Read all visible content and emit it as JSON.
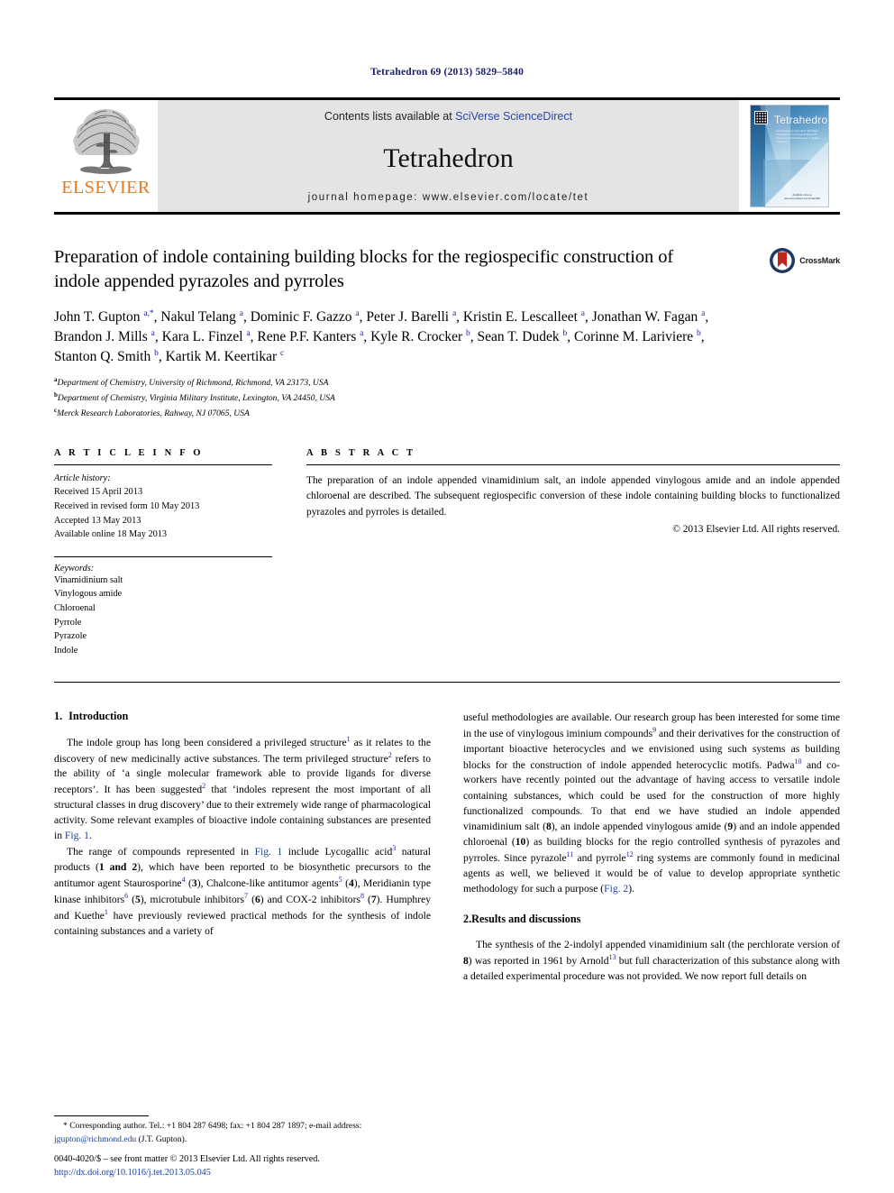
{
  "running_head": "Tetrahedron 69 (2013) 5829–5840",
  "masthead": {
    "publisher_name": "ELSEVIER",
    "contents_prefix": "Contents lists available at ",
    "contents_link": "SciVerse ScienceDirect",
    "journal_name": "Tetrahedron",
    "homepage": "journal homepage: www.elsevier.com/locate/tet",
    "cover": {
      "title": "Tetrahedron",
      "subtitle": "An International Journal for the Rapid Publication of Full Original Research Papers and Critical Reviews in Organic Chemistry",
      "footer": "Available online at www.sciencedirect.com ELSEVIER"
    }
  },
  "article": {
    "title": "Preparation of indole containing building blocks for the regiospecific construction of indole appended pyrazoles and pyrroles",
    "crossmark_label": "CrossMark",
    "authors_html": "John T. Gupton <sup>a,*</sup>, Nakul Telang <sup>a</sup>, Dominic F. Gazzo <sup>a</sup>, Peter J. Barelli <sup>a</sup>, Kristin E. Lescalleet <sup>a</sup>, Jonathan W. Fagan <sup>a</sup>, Brandon J. Mills <sup>a</sup>, Kara L. Finzel <sup>a</sup>, Rene P.F. Kanters <sup>a</sup>, Kyle R. Crocker <sup>b</sup>, Sean T. Dudek <sup>b</sup>, Corinne M. Lariviere <sup>b</sup>, Stanton Q. Smith <sup>b</sup>, Kartik M. Keertikar <sup>c</sup>",
    "affiliations": [
      {
        "marker": "a",
        "text": "Department of Chemistry, University of Richmond, Richmond, VA 23173, USA"
      },
      {
        "marker": "b",
        "text": "Department of Chemistry, Virginia Military Institute, Lexington, VA 24450, USA"
      },
      {
        "marker": "c",
        "text": "Merck Research Laboratories, Rahway, NJ 07065, USA"
      }
    ]
  },
  "info": {
    "heading": "A R T I C L E   I N F O",
    "history_label": "Article history:",
    "history": [
      "Received 15 April 2013",
      "Received in revised form 10 May 2013",
      "Accepted 13 May 2013",
      "Available online 18 May 2013"
    ],
    "keywords_label": "Keywords:",
    "keywords": [
      "Vinamidinium salt",
      "Vinylogous amide",
      "Chloroenal",
      "Pyrrole",
      "Pyrazole",
      "Indole"
    ]
  },
  "abstract": {
    "heading": "A B S T R A C T",
    "text": "The preparation of an indole appended vinamidinium salt, an indole appended vinylogous amide and an indole appended chloroenal are described. The subsequent regiospecific conversion of these indole containing building blocks to functionalized pyrazoles and pyrroles is detailed.",
    "copyright": "© 2013 Elsevier Ltd. All rights reserved."
  },
  "sections": {
    "introduction": {
      "number": "1.",
      "title": "Introduction"
    },
    "results": {
      "number": "2.",
      "title": "Results and discussions"
    }
  },
  "body": {
    "left_p1_html": "The indole group has long been considered a privileged structure<sup>1</sup> as it relates to the discovery of new medicinally active substances. The term privileged structure<sup>2</sup> refers to the ability of ‘a single molecular framework able to provide ligands for diverse receptors’. It has been suggested<sup>2</sup> that ‘indoles represent the most important of all structural classes in drug discovery’ due to their extremely wide range of pharmacological activity. Some relevant examples of bioactive indole containing substances are presented in <span class=\"lnk\">Fig. 1</span>.",
    "left_p2_html": "The range of compounds represented in <span class=\"lnk\">Fig. 1</span> include Lycogallic acid<sup>3</sup> natural products (<span class=\"bold\">1 and 2</span>), which have been reported to be biosynthetic precursors to the antitumor agent Staurosporine<sup>4</sup> (<span class=\"bold\">3</span>), Chalcone-like antitumor agents<sup>5</sup> (<span class=\"bold\">4</span>), Meridianin type kinase inhibitors<sup>6</sup> (<span class=\"bold\">5</span>), microtubule inhibitors<sup>7</sup> (<span class=\"bold\">6</span>) and COX-2 inhibitors<sup>8</sup> (<span class=\"bold\">7</span>). Humphrey and Kuethe<sup>1</sup> have previously reviewed practical methods for the synthesis of indole containing substances and a variety of",
    "right_p1_html": "useful methodologies are available. Our research group has been interested for some time in the use of vinylogous iminium compounds<sup>9</sup> and their derivatives for the construction of important bioactive heterocycles and we envisioned using such systems as building blocks for the construction of indole appended heterocyclic motifs. Padwa<sup>10</sup> and co-workers have recently pointed out the advantage of having access to versatile indole containing substances, which could be used for the construction of more highly functionalized compounds. To that end we have studied an indole appended vinamidinium salt (<span class=\"bold\">8</span>), an indole appended vinylogous amide (<span class=\"bold\">9</span>) and an indole appended chloroenal (<span class=\"bold\">10</span>) as building blocks for the regio controlled synthesis of pyrazoles and pyrroles. Since pyrazole<sup>11</sup> and pyrrole<sup>12</sup> ring systems are commonly found in medicinal agents as well, we believed it would be of value to develop appropriate synthetic methodology for such a purpose (<span class=\"lnk\">Fig. 2</span>).",
    "right_p2_html": "The synthesis of the 2-indolyl appended vinamidinium salt (the perchlorate version of <span class=\"bold\">8</span>) was reported in 1961 by Arnold<sup>13</sup> but full characterization of this substance along with a detailed experimental procedure was not provided. We now report full details on"
  },
  "footnote": {
    "text_html": "* Corresponding author. Tel.: +1 804 287 6498; fax: +1 804 287 1897; e-mail address: <span class=\"mail\">jgupton@richmond.edu</span> (J.T. Gupton)."
  },
  "footer": {
    "issn_line": "0040-4020/$ – see front matter © 2013 Elsevier Ltd. All rights reserved.",
    "doi": "http://dx.doi.org/10.1016/j.tet.2013.05.045"
  },
  "colors": {
    "link_blue": "#1a3fa0",
    "running_head_navy": "#1a1a6e",
    "elsevier_orange": "#e87722",
    "masthead_gray": "#e4e4e4",
    "crossmark_red": "#c0261b",
    "crossmark_navy": "#1f3864"
  }
}
